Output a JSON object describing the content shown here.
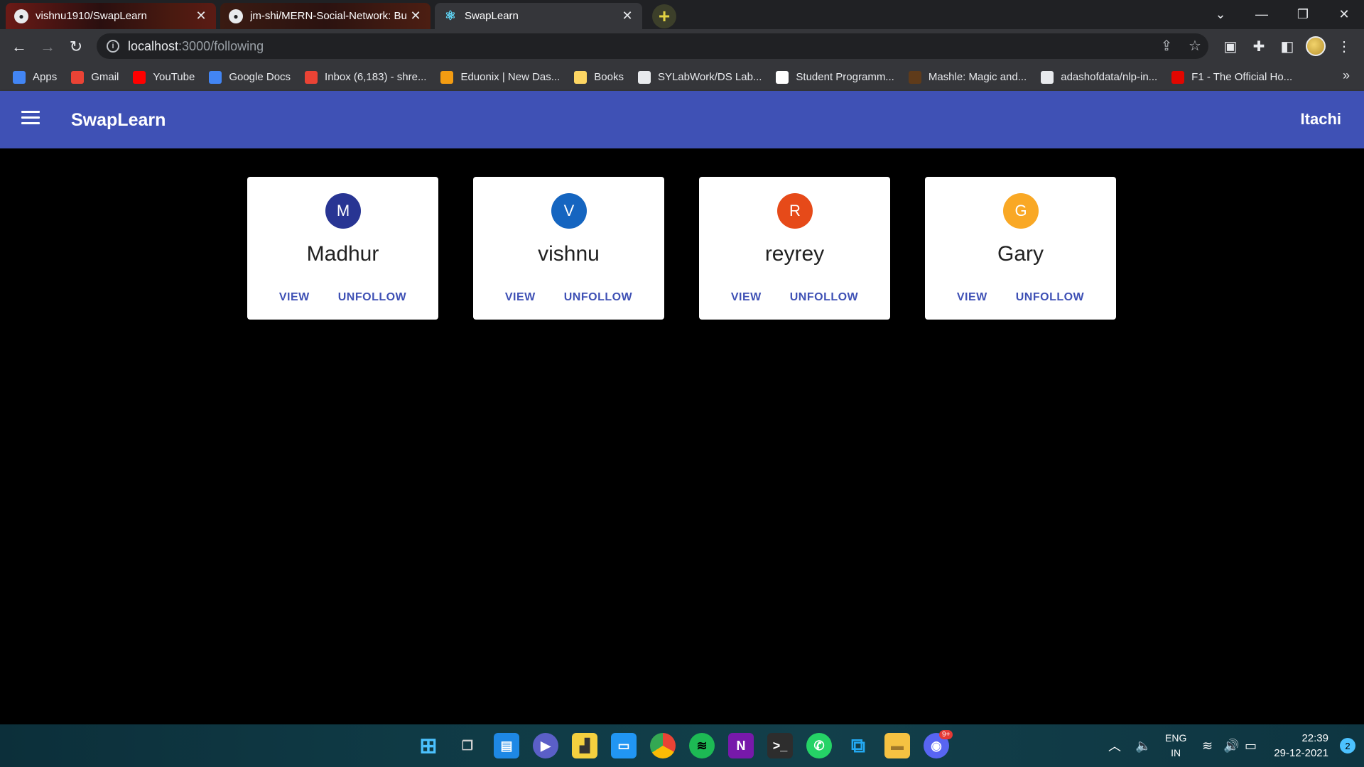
{
  "browser": {
    "tabs": [
      {
        "title": "vishnu1910/SwapLearn",
        "icon": "github-icon"
      },
      {
        "title": "jm-shi/MERN-Social-Network: Bu",
        "icon": "github-icon"
      },
      {
        "title": "SwapLearn",
        "icon": "react-icon"
      }
    ],
    "url_host": "localhost",
    "url_path": ":3000/following",
    "bookmarks": [
      {
        "label": "Apps",
        "icon": "apps-grid-icon",
        "color": "#4285f4"
      },
      {
        "label": "Gmail",
        "icon": "gmail-icon",
        "color": "#ea4335"
      },
      {
        "label": "YouTube",
        "icon": "youtube-icon",
        "color": "#ff0000"
      },
      {
        "label": "Google Docs",
        "icon": "docs-icon",
        "color": "#4285f4"
      },
      {
        "label": "Inbox (6,183) - shre...",
        "icon": "gmail-icon",
        "color": "#ea4335"
      },
      {
        "label": "Eduonix | New Das...",
        "icon": "eduonix-icon",
        "color": "#f39c12"
      },
      {
        "label": "Books",
        "icon": "folder-icon",
        "color": "#fdd663"
      },
      {
        "label": "SYLabWork/DS Lab...",
        "icon": "github-icon",
        "color": "#e8eaed"
      },
      {
        "label": "Student Programm...",
        "icon": "amazon-icon",
        "color": "#ffffff"
      },
      {
        "label": "Mashle: Magic and...",
        "icon": "manga-icon",
        "color": "#5f3b1a"
      },
      {
        "label": "adashofdata/nlp-in...",
        "icon": "github-icon",
        "color": "#e8eaed"
      },
      {
        "label": "F1 - The Official Ho...",
        "icon": "f1-icon",
        "color": "#e10600"
      }
    ]
  },
  "app": {
    "brand": "SwapLearn",
    "user": "Itachi",
    "accent": "#3f51b5"
  },
  "following": [
    {
      "initial": "M",
      "name": "Madhur",
      "color": "#283593",
      "view_label": "VIEW",
      "unfollow_label": "UNFOLLOW"
    },
    {
      "initial": "V",
      "name": "vishnu",
      "color": "#1565c0",
      "view_label": "VIEW",
      "unfollow_label": "UNFOLLOW"
    },
    {
      "initial": "R",
      "name": "reyrey",
      "color": "#e64a19",
      "view_label": "VIEW",
      "unfollow_label": "UNFOLLOW"
    },
    {
      "initial": "G",
      "name": "Gary",
      "color": "#f9a825",
      "view_label": "VIEW",
      "unfollow_label": "UNFOLLOW"
    }
  ],
  "taskbar": {
    "lang_top": "ENG",
    "lang_bottom": "IN",
    "time": "22:39",
    "date": "29-12-2021",
    "notifications": "2",
    "discord_badge": "9+"
  }
}
